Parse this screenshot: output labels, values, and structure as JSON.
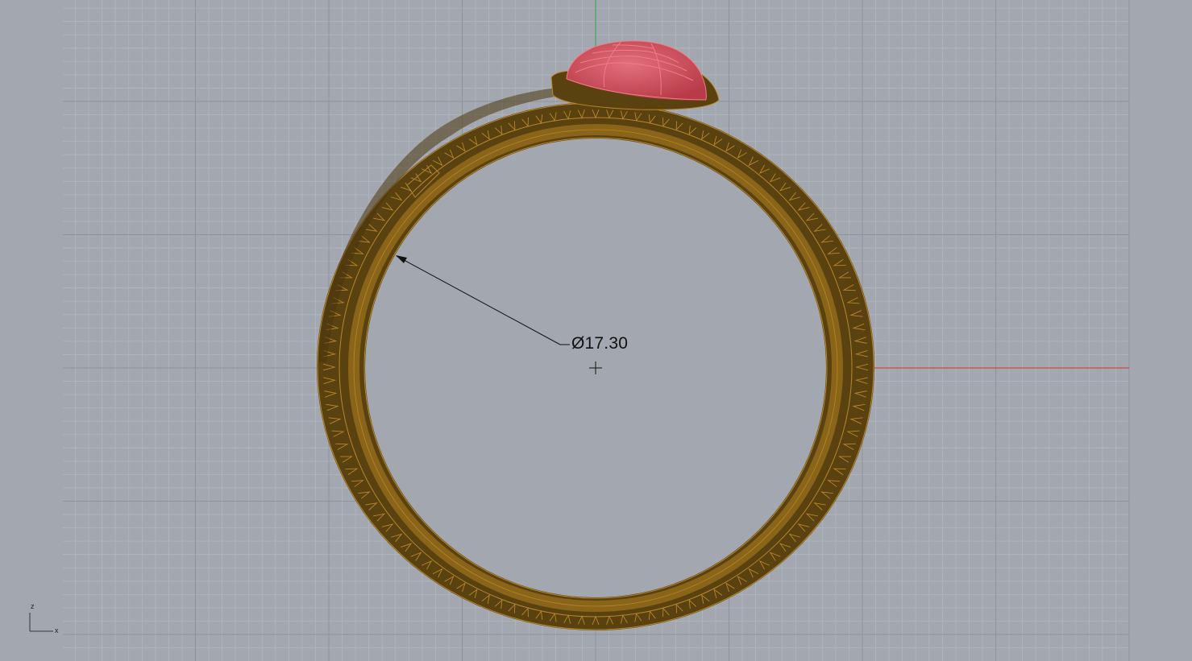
{
  "viewport": {
    "view": "Front",
    "background_color": "#a3a8b0",
    "grid_minor_color": "#b1b5bc",
    "grid_major_color": "#8f949b",
    "x_axis_color": "#c0392b",
    "z_axis_color": "#27a844"
  },
  "model": {
    "ring_color": "#5a4210",
    "ring_edge_color": "#b8862b",
    "gem_color": "#cc4a55",
    "gem_edge_color": "#f07d88"
  },
  "dimension": {
    "label": "Ø17.30"
  },
  "gizmo": {
    "z_label": "z",
    "x_label": "x"
  }
}
